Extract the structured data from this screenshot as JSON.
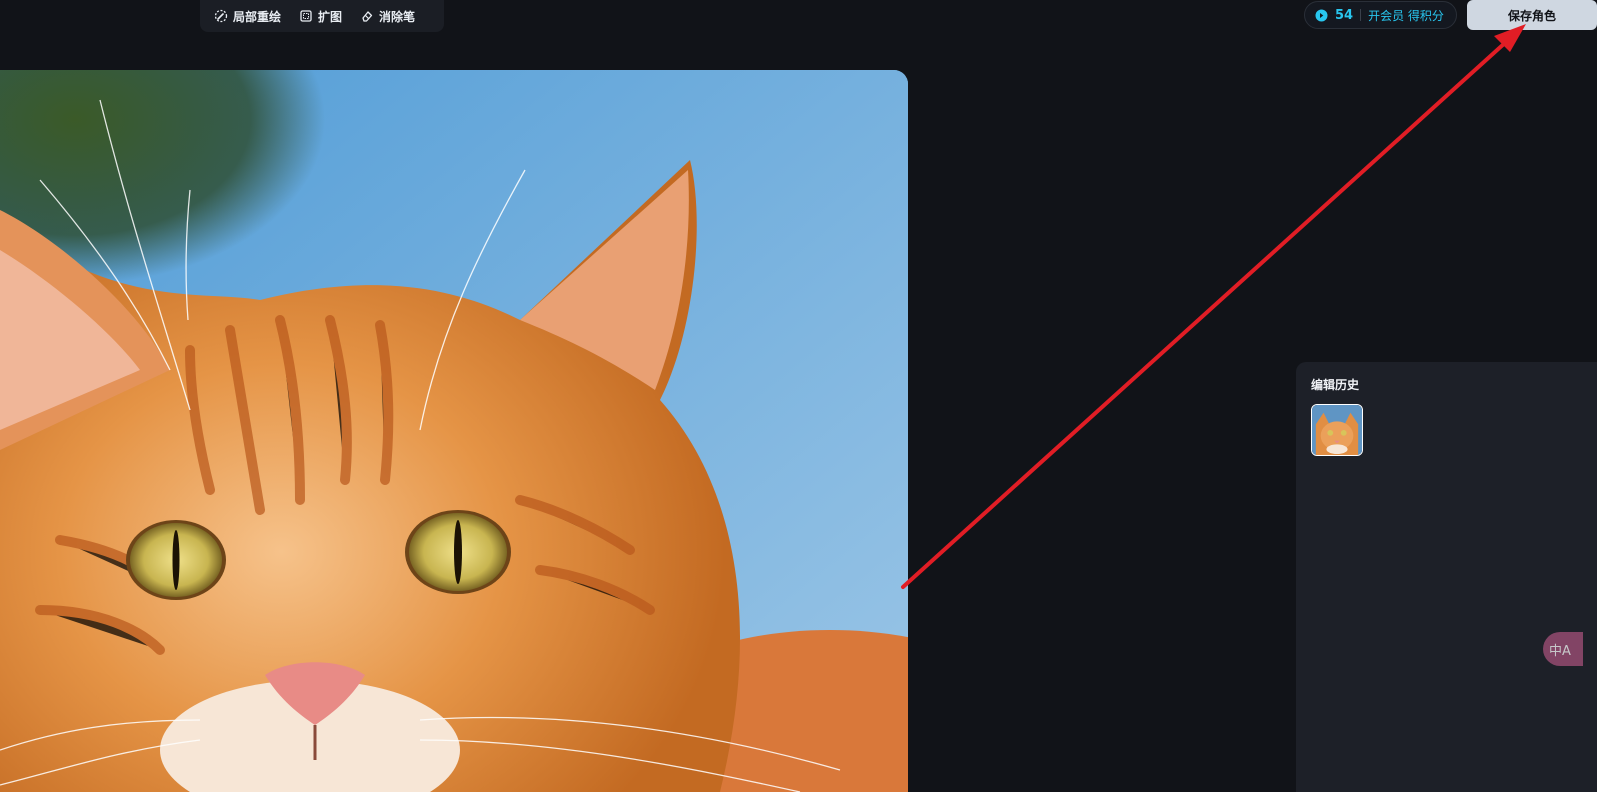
{
  "toolbar": {
    "inpaint_label": "局部重绘",
    "outpaint_label": "扩图",
    "eraser_label": "消除笔"
  },
  "account": {
    "points": "54",
    "member_label": "开会员 得积分"
  },
  "actions": {
    "save_label": "保存角色"
  },
  "history": {
    "title": "编辑历史"
  },
  "floating": {
    "help_glyph": "中A"
  },
  "colors": {
    "background": "#111318",
    "accent": "#28c6ef",
    "save_button_bg": "#cfd7e1",
    "panel_bg": "#1d2028",
    "annotation_arrow": "#e11d25"
  },
  "icons": {
    "inpaint": "brush-dotted-icon",
    "outpaint": "expand-square-icon",
    "eraser": "eraser-icon",
    "points": "coin-arrow-icon"
  }
}
